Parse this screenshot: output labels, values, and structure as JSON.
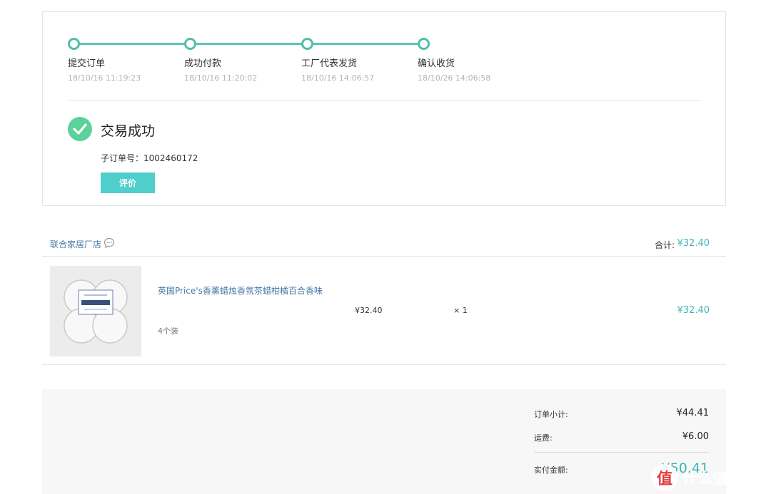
{
  "progress": {
    "steps": [
      {
        "label": "提交订单",
        "time": "18/10/16 11:19:23"
      },
      {
        "label": "成功付款",
        "time": "18/10/16 11:20:02"
      },
      {
        "label": "工厂代表发货",
        "time": "18/10/16 14:06:57"
      },
      {
        "label": "确认收货",
        "time": "18/10/26 14:06:58"
      }
    ],
    "color": "#5dc4b0"
  },
  "status": {
    "title": "交易成功",
    "order_no_label": "子订单号：",
    "order_no": "1002460172",
    "review_button": "评价",
    "icon": "check-circle-icon",
    "icon_color": "#5bd29a"
  },
  "shop": {
    "name": "联合家居厂店",
    "chat_icon": "chat-bubble-icon",
    "total_label": "合计:",
    "total_value": "¥32.40"
  },
  "item": {
    "title": "英国Price's香薰蜡烛香氛茶蜡柑橘百合香味",
    "spec": "4个装",
    "price": "¥32.40",
    "qty": "× 1",
    "subtotal": "¥32.40"
  },
  "summary": {
    "subtotal_label": "订单小计:",
    "subtotal_value": "¥44.41",
    "shipping_label": "运费:",
    "shipping_value": "¥6.00",
    "paid_label": "实付金额:",
    "paid_value": "¥50.41"
  },
  "watermark": {
    "badge": "值",
    "text": "什么值得买"
  },
  "colors": {
    "accent": "#3fb5b5",
    "button": "#4fcfcb",
    "link": "#4a7aa7"
  }
}
